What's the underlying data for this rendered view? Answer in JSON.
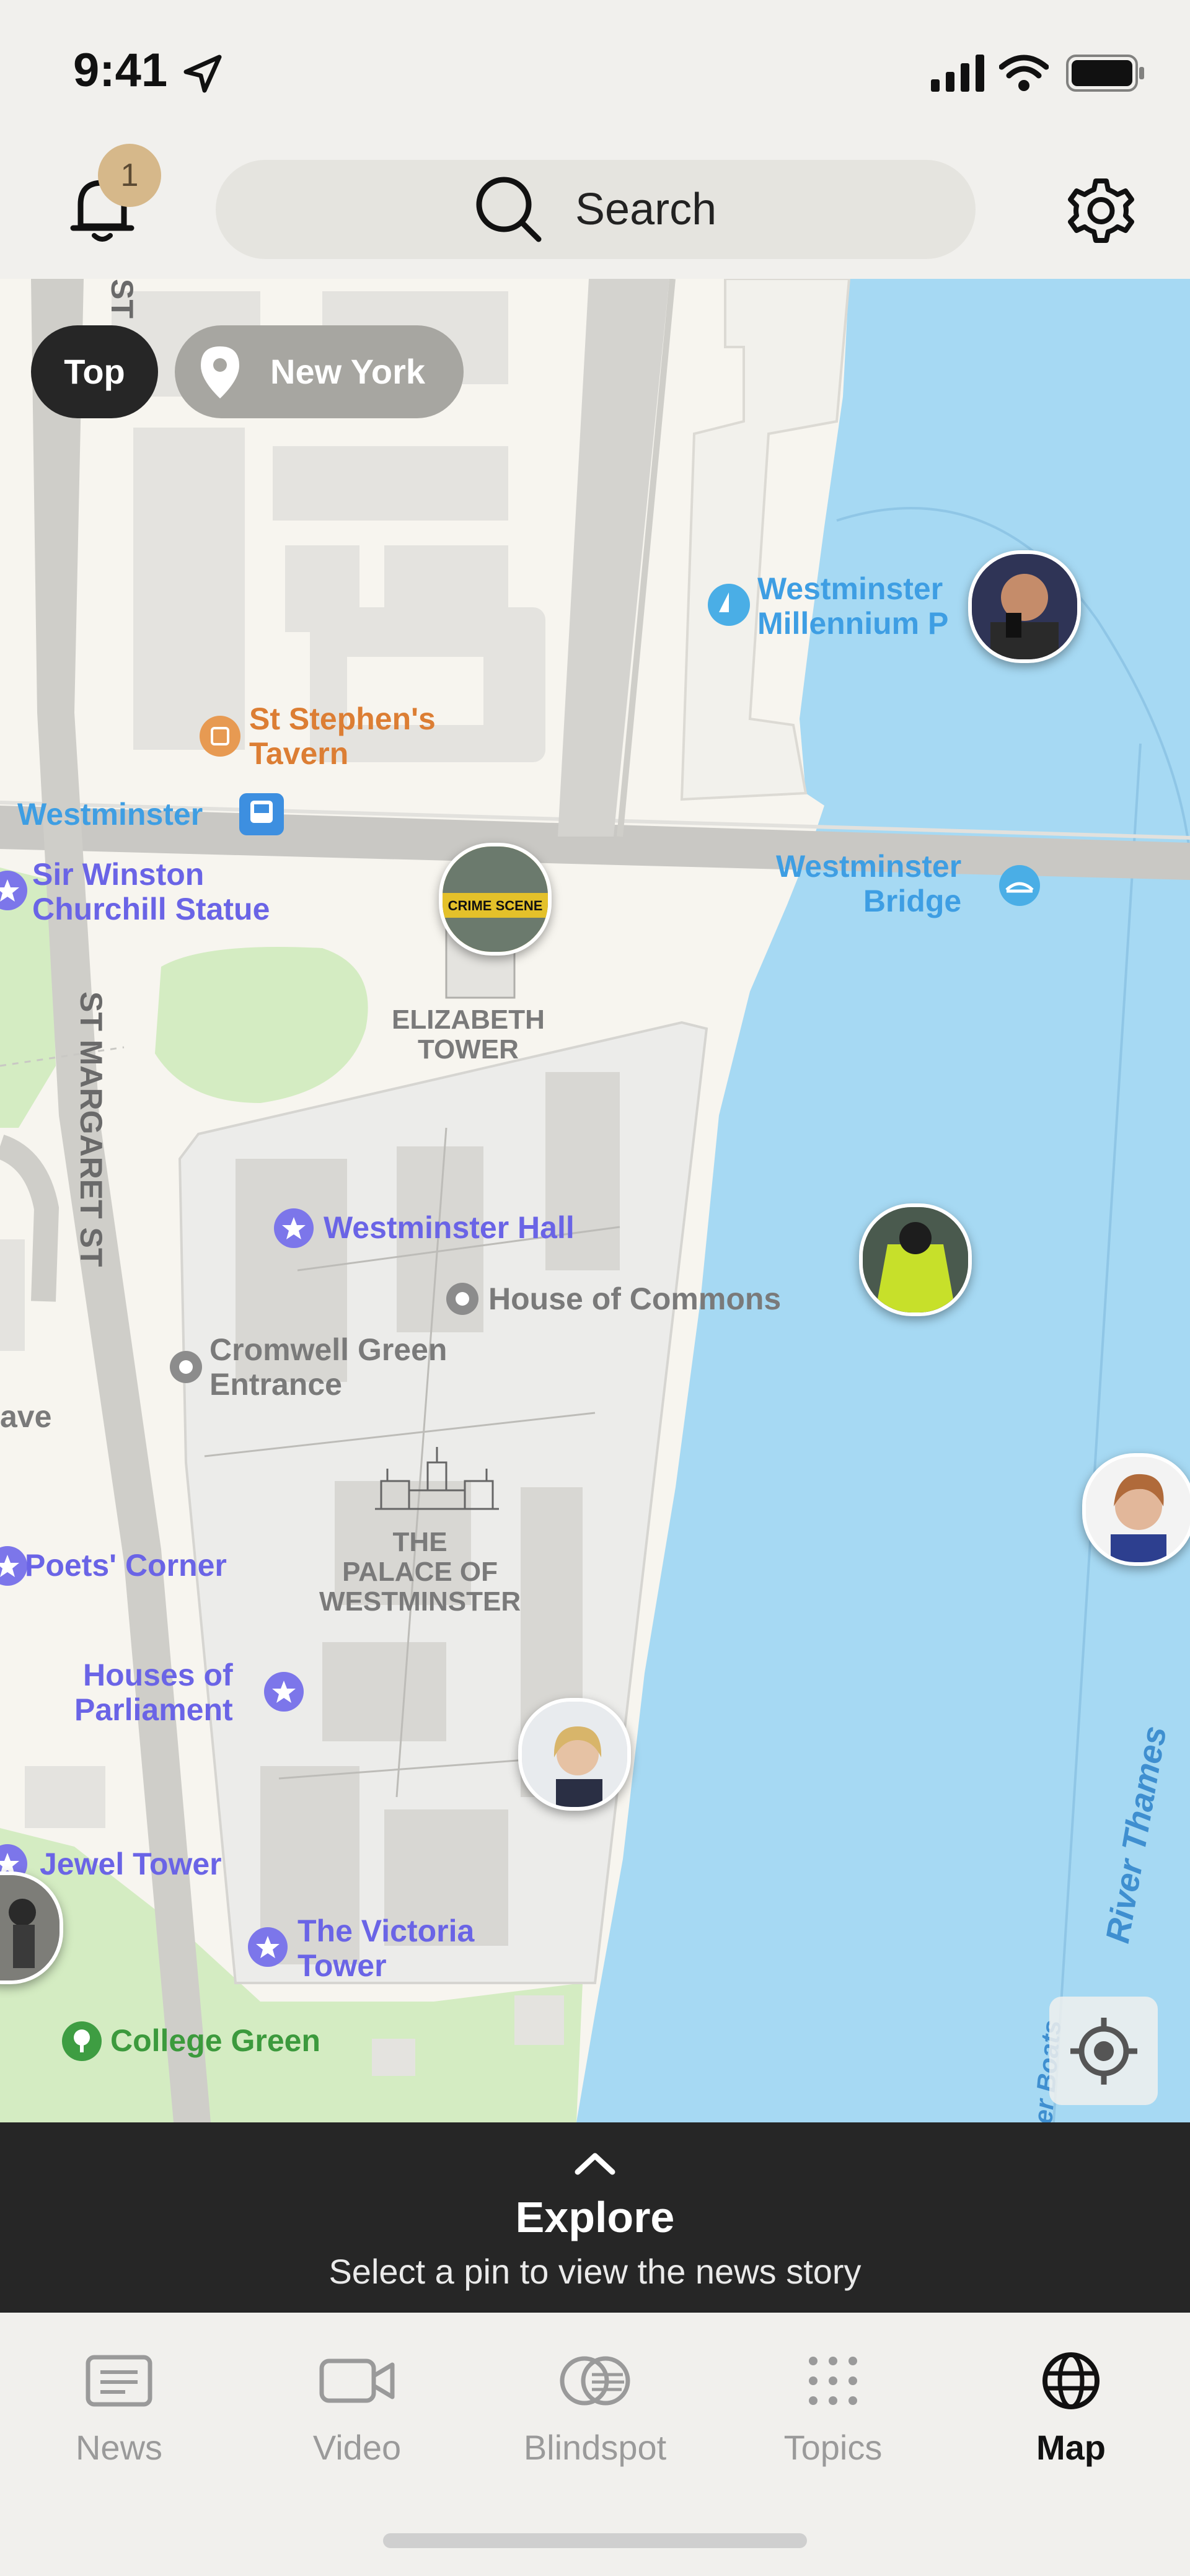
{
  "status_bar": {
    "time": "9:41"
  },
  "header": {
    "notification_count": "1",
    "search_label": "Search"
  },
  "filters": {
    "top": "Top",
    "location": "New York"
  },
  "map": {
    "labels": {
      "westminster_pier": "Westminster\nMillennium P",
      "st_stephens": "St Stephen's\nTavern",
      "westminster_station": "Westminster",
      "churchill": "Sir Winston\nChurchill Statue",
      "westminster_bridge": "Westminster\nBridge",
      "elizabeth_tower": "ELIZABETH\nTOWER",
      "st_margaret": "ST MARGARET ST",
      "st_top": "ST",
      "westminster_hall": "Westminster Hall",
      "house_of_commons": "House of Commons",
      "cromwell": "Cromwell Green\nEntrance",
      "ave": "ave",
      "palace": "THE\nPALACE OF\nWESTMINSTER",
      "poets_corner": "Poets' Corner",
      "houses_of_parliament": "Houses of\nParliament",
      "jewel_tower": "Jewel Tower",
      "victoria_tower": "The Victoria\nTower",
      "college_green": "College Green",
      "river_thames": "River Thames",
      "river_boats": "er Boats"
    },
    "pins": [
      "boxer-pin",
      "crime-scene-pin",
      "worker-pin",
      "politician-woman-pin",
      "protester-pin",
      "politician-blonde-pin"
    ],
    "pin_texts": {
      "crime_scene": "CRIME SCENE"
    },
    "icons": [
      "location-pin-icon",
      "star-icon",
      "train-icon",
      "ferry-icon",
      "restaurant-icon",
      "tree-icon",
      "locate-me-icon"
    ]
  },
  "explore": {
    "title": "Explore",
    "subtitle": "Select a pin to view the news story"
  },
  "tabs": [
    {
      "label": "News",
      "icon": "newspaper-icon",
      "active": false
    },
    {
      "label": "Video",
      "icon": "video-camera-icon",
      "active": false
    },
    {
      "label": "Blindspot",
      "icon": "blindspot-icon",
      "active": false
    },
    {
      "label": "Topics",
      "icon": "grid-dots-icon",
      "active": false
    },
    {
      "label": "Map",
      "icon": "globe-icon",
      "active": true
    }
  ],
  "colors": {
    "accent": "#6a64e6",
    "water": "#a6d9f3",
    "panel": "#262626",
    "badge": "#d6b88a"
  }
}
